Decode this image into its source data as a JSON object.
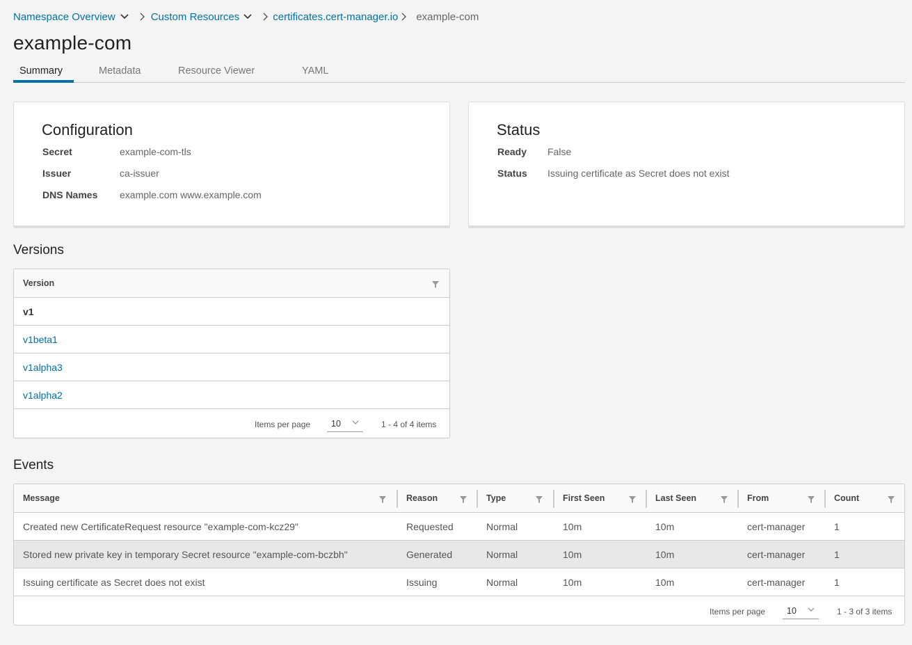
{
  "breadcrumb": {
    "items": [
      "Namespace Overview",
      "Custom Resources",
      "certificates.cert-manager.io",
      "example-com"
    ]
  },
  "page": {
    "title": "example-com"
  },
  "tabs": [
    "Summary",
    "Metadata",
    "Resource Viewer",
    "YAML"
  ],
  "configuration": {
    "title": "Configuration",
    "rows": [
      {
        "label": "Secret",
        "value": "example-com-tls"
      },
      {
        "label": "Issuer",
        "value": "ca-issuer"
      },
      {
        "label": "DNS Names",
        "value": "example.com www.example.com"
      }
    ]
  },
  "status": {
    "title": "Status",
    "rows": [
      {
        "label": "Ready",
        "value": "False"
      },
      {
        "label": "Status",
        "value": "Issuing certificate as Secret does not exist"
      }
    ]
  },
  "versions": {
    "title": "Versions",
    "column": "Version",
    "rows": [
      "v1",
      "v1beta1",
      "v1alpha3",
      "v1alpha2"
    ],
    "items_per_page_label": "Items per page",
    "items_per_page": "10",
    "range": "1 - 4 of 4 items"
  },
  "events": {
    "title": "Events",
    "columns": [
      "Message",
      "Reason",
      "Type",
      "First Seen",
      "Last Seen",
      "From",
      "Count"
    ],
    "rows": [
      [
        "Created new CertificateRequest resource \"example-com-kcz29\"",
        "Requested",
        "Normal",
        "10m",
        "10m",
        "cert-manager",
        "1"
      ],
      [
        "Stored new private key in temporary Secret resource \"example-com-bczbh\"",
        "Generated",
        "Normal",
        "10m",
        "10m",
        "cert-manager",
        "1"
      ],
      [
        "Issuing certificate as Secret does not exist",
        "Issuing",
        "Normal",
        "10m",
        "10m",
        "cert-manager",
        "1"
      ]
    ],
    "items_per_page_label": "Items per page",
    "items_per_page": "10",
    "range": "1 - 3 of 3 items"
  },
  "colors": {
    "link": "#0072a3",
    "accent": "#0072a3",
    "row_highlight": "#e8e8e8"
  }
}
